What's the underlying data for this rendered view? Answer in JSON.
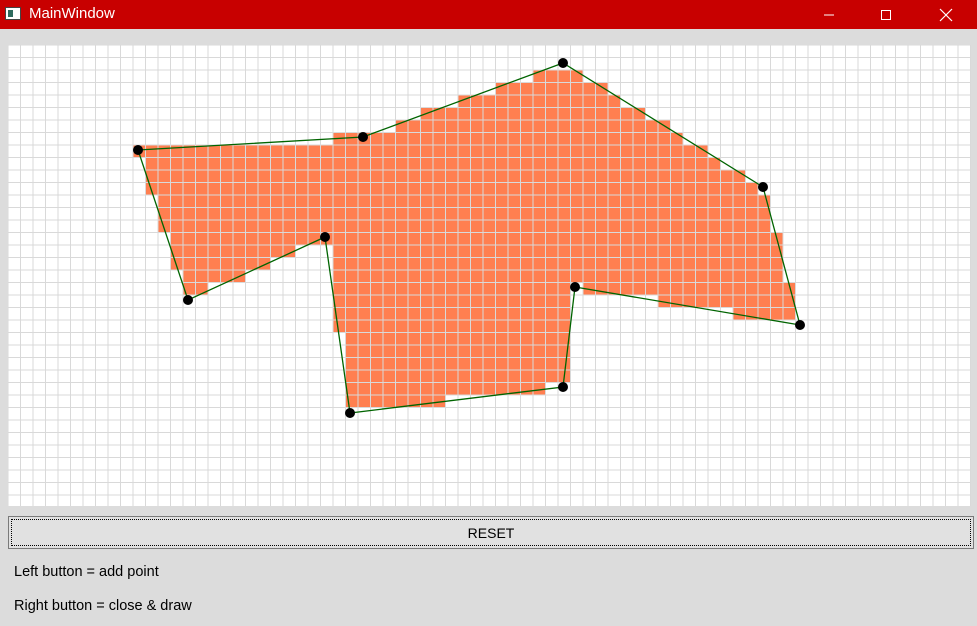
{
  "window": {
    "title": "MainWindow",
    "titlebar_color": "#c80000",
    "controls": [
      "minimize-icon",
      "maximize-icon",
      "close-icon"
    ]
  },
  "canvas": {
    "grid_color": "#d9d9d9",
    "fill_color": "#ff7f50",
    "outline_color": "#006400",
    "vertex_color": "#000000"
  },
  "buttons": {
    "reset_label": "RESET"
  },
  "instructions": {
    "left_button": "Left button = add point",
    "right_button": "Right button = close & draw"
  }
}
